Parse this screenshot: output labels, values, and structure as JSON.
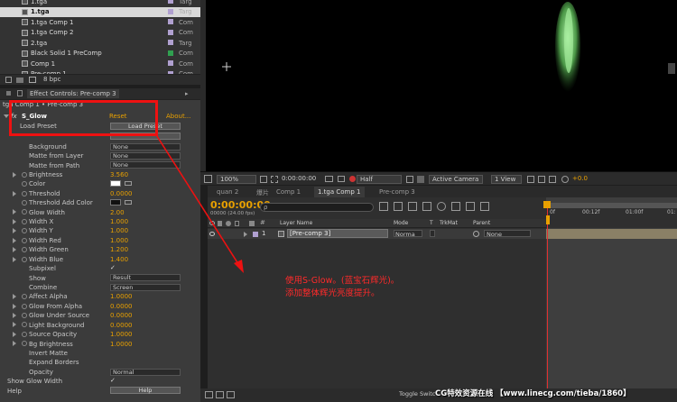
{
  "project": {
    "items": [
      {
        "name": "1.tga",
        "type": "Targ",
        "label_color": "#b0a0d0",
        "selected": false
      },
      {
        "name": "1.tga",
        "type": "Targ",
        "label_color": "#b0a0d0",
        "selected": true
      },
      {
        "name": "1.tga Comp 1",
        "type": "Com",
        "label_color": "#b0a0d0",
        "selected": false
      },
      {
        "name": "1.tga Comp 2",
        "type": "Com",
        "label_color": "#b0a0d0",
        "selected": false
      },
      {
        "name": "2.tga",
        "type": "Targ",
        "label_color": "#b0a0d0",
        "selected": false
      },
      {
        "name": "Black Solid 1 PreComp",
        "type": "Com",
        "label_color": "#30a050",
        "selected": false
      },
      {
        "name": "Comp 1",
        "type": "Com",
        "label_color": "#b0a0d0",
        "selected": false
      },
      {
        "name": "Pre-comp 1",
        "type": "Com",
        "label_color": "#b0a0d0",
        "selected": false
      }
    ],
    "bpc": "8 bpc"
  },
  "effect_controls": {
    "tab_label": "Effect Controls: Pre-comp 3",
    "breadcrumb": "tga Comp 1 • Pre-comp 3",
    "fx_badge": "fx",
    "effect_name": "S_Glow",
    "reset": "Reset",
    "about": "About...",
    "load_preset_label": "Load Preset",
    "load_preset_button": "Load Preset",
    "params": [
      {
        "name": "Background",
        "kind": "dropdown",
        "value": "None",
        "twirl": false,
        "stopwatch": false
      },
      {
        "name": "Matte from Layer",
        "kind": "dropdown",
        "value": "None",
        "twirl": false,
        "stopwatch": false
      },
      {
        "name": "Matte from Path",
        "kind": "dropdown",
        "value": "None",
        "twirl": false,
        "stopwatch": false
      },
      {
        "name": "Brightness",
        "kind": "number",
        "value": "3.560",
        "twirl": true,
        "stopwatch": true
      },
      {
        "name": "Color",
        "kind": "color",
        "value": "",
        "color": "#ffffff",
        "twirl": false,
        "stopwatch": true
      },
      {
        "name": "Threshold",
        "kind": "number",
        "value": "0.0000",
        "twirl": true,
        "stopwatch": true
      },
      {
        "name": "Threshold Add Color",
        "kind": "color",
        "value": "",
        "color": "#111111",
        "twirl": false,
        "stopwatch": true
      },
      {
        "name": "Glow Width",
        "kind": "number",
        "value": "2.00",
        "twirl": true,
        "stopwatch": true
      },
      {
        "name": "Width X",
        "kind": "number",
        "value": "1.000",
        "twirl": true,
        "stopwatch": true
      },
      {
        "name": "Width Y",
        "kind": "number",
        "value": "1.000",
        "twirl": true,
        "stopwatch": true
      },
      {
        "name": "Width Red",
        "kind": "number",
        "value": "1.000",
        "twirl": true,
        "stopwatch": true
      },
      {
        "name": "Width Green",
        "kind": "number",
        "value": "1.200",
        "twirl": true,
        "stopwatch": true
      },
      {
        "name": "Width Blue",
        "kind": "number",
        "value": "1.400",
        "twirl": true,
        "stopwatch": true
      },
      {
        "name": "Subpixel",
        "kind": "checkbox",
        "value": "",
        "checked": true,
        "twirl": false,
        "stopwatch": false
      },
      {
        "name": "Show",
        "kind": "dropdown",
        "value": "Result",
        "twirl": false,
        "stopwatch": false
      },
      {
        "name": "Combine",
        "kind": "dropdown",
        "value": "Screen",
        "twirl": false,
        "stopwatch": false
      },
      {
        "name": "Affect Alpha",
        "kind": "number",
        "value": "1.0000",
        "twirl": true,
        "stopwatch": true
      },
      {
        "name": "Glow From Alpha",
        "kind": "number",
        "value": "0.0000",
        "twirl": true,
        "stopwatch": true
      },
      {
        "name": "Glow Under Source",
        "kind": "number",
        "value": "0.0000",
        "twirl": true,
        "stopwatch": true
      },
      {
        "name": "Light Background",
        "kind": "number",
        "value": "0.0000",
        "twirl": true,
        "stopwatch": true
      },
      {
        "name": "Source Opacity",
        "kind": "number",
        "value": "1.0000",
        "twirl": true,
        "stopwatch": true
      },
      {
        "name": "Bg Brightness",
        "kind": "number",
        "value": "1.0000",
        "twirl": true,
        "stopwatch": true
      },
      {
        "name": "Invert Matte",
        "kind": "checkbox",
        "value": "",
        "checked": false,
        "twirl": false,
        "stopwatch": false
      },
      {
        "name": "Expand Borders",
        "kind": "checkbox",
        "value": "",
        "checked": false,
        "twirl": false,
        "stopwatch": false
      },
      {
        "name": "Opacity",
        "kind": "dropdown",
        "value": "Normal",
        "twirl": false,
        "stopwatch": false
      },
      {
        "name": "Show Glow Width",
        "kind": "checkbox",
        "value": "",
        "checked": true,
        "twirl": false,
        "stopwatch": false,
        "indent": "top"
      },
      {
        "name": "Help",
        "kind": "button",
        "value": "Help",
        "twirl": false,
        "stopwatch": false,
        "indent": "top"
      }
    ]
  },
  "viewer": {
    "zoom": "100%",
    "timecode": "0:00:00:00",
    "resolution": "Half",
    "camera": "Active Camera",
    "view": "1 View",
    "exposure": "+0.0"
  },
  "timeline": {
    "tabs": [
      "quan 2",
      "爆片",
      "Comp 1",
      "1.tga Comp 1",
      "Pre-comp 3"
    ],
    "active_tab_index": 3,
    "timecode": "0:00:00:00",
    "frame_info": "00000 (24.00 fps)",
    "search_placeholder": "ρ",
    "columns": {
      "layer_name": "Layer Name",
      "mode": "Mode",
      "t": "T",
      "trkmat": "TrkMat",
      "parent": "Parent"
    },
    "ruler": [
      "0f",
      "00:12f",
      "01:00f",
      "01:"
    ],
    "layer": {
      "number": "1",
      "name": "[Pre-comp 3]",
      "mode": "Norma",
      "parent": "None"
    },
    "toggle_label": "Toggle Switc"
  },
  "annotation": {
    "line1": "使用S-Glow。(蓝宝石辉光)。",
    "line2": "添加整体辉光亮度提升。"
  },
  "watermark": "CG特效资源在线  【www.linecg.com/tieba/1860】",
  "colors": {
    "accent_value": "#e8a000",
    "timecode": "#e8a000",
    "annotation": "#ff2a2a",
    "glow": "#7ddc7d"
  }
}
